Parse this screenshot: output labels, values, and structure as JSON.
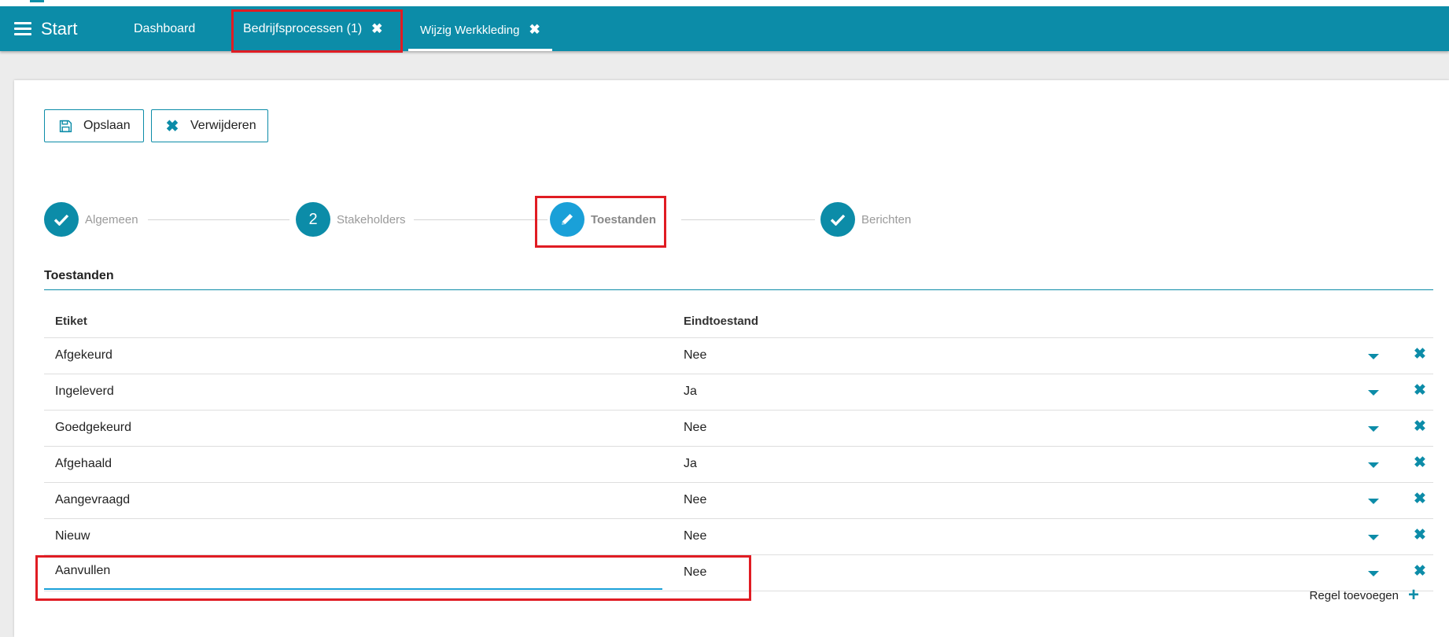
{
  "nav": {
    "start_label": "Start",
    "tabs": [
      {
        "label": "Dashboard"
      },
      {
        "label": "Bedrijfsprocessen (1)",
        "close": "✖"
      },
      {
        "label": "Wijzig Werkkleding",
        "close": "✖"
      }
    ]
  },
  "toolbar": {
    "save_label": "Opslaan",
    "delete_label": "Verwijderen"
  },
  "stepper": {
    "steps": [
      {
        "label": "Algemeen",
        "state": "done"
      },
      {
        "label": "Stakeholders",
        "number": "2",
        "state": "pending"
      },
      {
        "label": "Toestanden",
        "state": "active"
      },
      {
        "label": "Berichten",
        "state": "done"
      }
    ]
  },
  "section": {
    "title": "Toestanden"
  },
  "table": {
    "headers": [
      "Etiket",
      "Eindtoestand"
    ],
    "rows": [
      {
        "etiket": "Afgekeurd",
        "eindtoestand": "Nee"
      },
      {
        "etiket": "Ingeleverd",
        "eindtoestand": "Ja"
      },
      {
        "etiket": "Goedgekeurd",
        "eindtoestand": "Nee"
      },
      {
        "etiket": "Afgehaald",
        "eindtoestand": "Ja"
      },
      {
        "etiket": "Aangevraagd",
        "eindtoestand": "Nee"
      },
      {
        "etiket": "Nieuw",
        "eindtoestand": "Nee"
      },
      {
        "etiket": "Aanvullen",
        "eindtoestand": "Nee"
      }
    ],
    "add_row_label": "Regel toevoegen"
  },
  "colors": {
    "primary": "#0c8ca8",
    "active_step": "#1aa0d8",
    "highlight": "#e01c23"
  }
}
